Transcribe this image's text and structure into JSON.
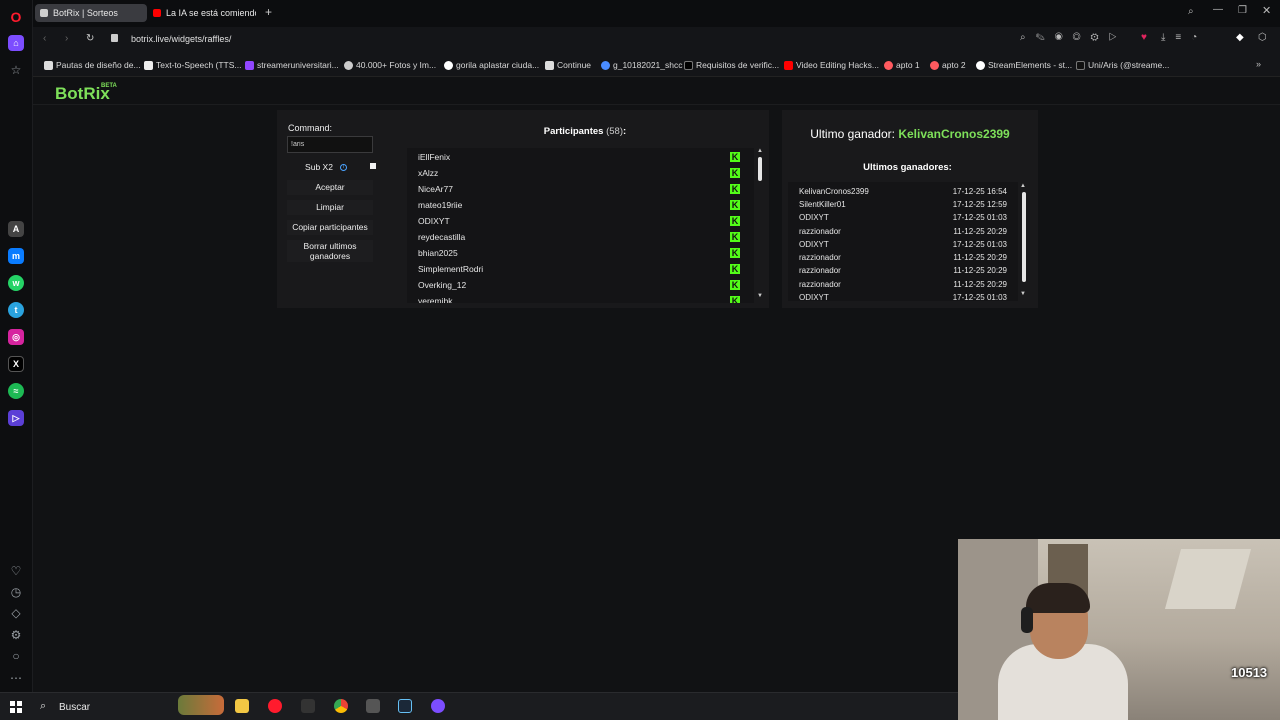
{
  "browser": {
    "tabs": [
      {
        "label": "BotRix | Sorteos",
        "active": true
      },
      {
        "label": "La IA se está comiendo la",
        "active": false
      }
    ],
    "new_tab_symbol": "+",
    "url": "botrix.live/widgets/raffles/",
    "bookmarks": [
      "Pautas de diseño de...",
      "Text-to-Speech (TTS...",
      "streameruniversitari...",
      "40.000+ Fotos y Im...",
      "gorila aplastar ciuda...",
      "Continue",
      "g_10182021_shcc",
      "Requisitos de verific...",
      "Video Editing Hacks...",
      "apto 1",
      "apto 2",
      "StreamElements - st...",
      "Uni/Aris (@streame..."
    ]
  },
  "app": {
    "logo": "BotRix",
    "logo_badge": "BETA"
  },
  "raffle": {
    "command_label": "Command:",
    "command_value": "!aris",
    "sub_x2_label": "Sub X2",
    "info_symbol": "i",
    "accept_label": "Aceptar",
    "clear_label": "Limpiar",
    "copy_label": "Copiar participantes",
    "delete_label": "Borrar ultimos ganadores",
    "participants_title": "Participantes",
    "participants_count": "(58)",
    "participants_colon": ":",
    "participants": [
      "iEllFenix",
      "xAlzz",
      "NiceAr77",
      "mateo19riie",
      "ODIXYT",
      "reydecastilla",
      "bhian2025",
      "SimplementRodri",
      "Overking_12",
      "yeremibk"
    ],
    "platform_badge": "K",
    "scroll_up": "▲",
    "scroll_down": "▼"
  },
  "winners": {
    "last_winner_label": "Ultimo ganador:",
    "last_winner_name": "KelivanCronos2399",
    "list_title": "Ultimos ganadores:",
    "items": [
      {
        "name": "KelivanCronos2399",
        "date": "17-12-25 16:54"
      },
      {
        "name": "SilentKiller01",
        "date": "17-12-25 12:59"
      },
      {
        "name": "ODIXYT",
        "date": "17-12-25 01:03"
      },
      {
        "name": "razzionador",
        "date": "11-12-25 20:29"
      },
      {
        "name": "ODIXYT",
        "date": "17-12-25 01:03"
      },
      {
        "name": "razzionador",
        "date": "11-12-25 20:29"
      },
      {
        "name": "razzionador",
        "date": "11-12-25 20:29"
      },
      {
        "name": "razzionador",
        "date": "11-12-25 20:29"
      },
      {
        "name": "ODIXYT",
        "date": "17-12-25 01:03"
      }
    ]
  },
  "webcam": {
    "counter": "10513"
  },
  "taskbar": {
    "search_label": "Buscar"
  },
  "colors": {
    "accent_green": "#7ee05a",
    "kick_green": "#53fc18",
    "opera_red": "#ff1b2d"
  }
}
